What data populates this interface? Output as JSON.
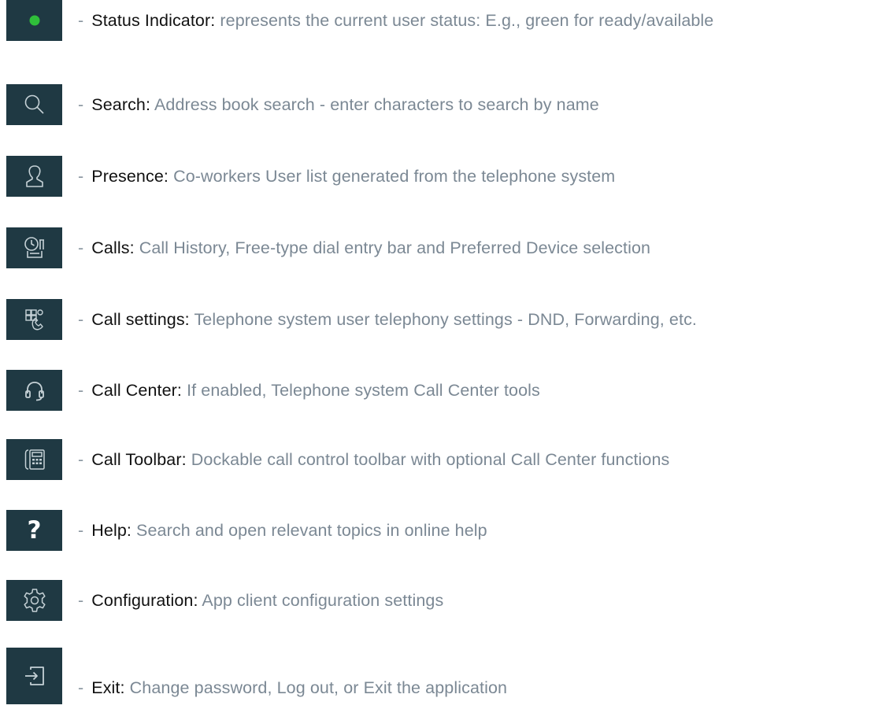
{
  "legend_items": [
    {
      "icon": "status-indicator-icon",
      "term": "Status Indicator",
      "description": "represents the current user status: E.g., green for ready/available"
    },
    {
      "icon": "search-icon",
      "term": "Search",
      "description": "Address book search - enter characters to search by name"
    },
    {
      "icon": "person-icon",
      "term": "Presence",
      "description": "Co-workers User list generated from the telephone system"
    },
    {
      "icon": "clock-phone-icon",
      "term": "Calls",
      "description": "Call History, Free-type dial entry bar and Preferred Device selection"
    },
    {
      "icon": "phone-settings-icon",
      "term": "Call settings",
      "description": "Telephone system user telephony settings - DND, Forwarding, etc."
    },
    {
      "icon": "headset-icon",
      "term": "Call Center",
      "description": "If enabled, Telephone system Call Center tools"
    },
    {
      "icon": "desk-phone-icon",
      "term": "Call Toolbar",
      "description": "Dockable call control toolbar with optional Call Center functions"
    },
    {
      "icon": "help-icon",
      "term": "Help",
      "description": "Search and open relevant topics in online help"
    },
    {
      "icon": "gear-icon",
      "term": "Configuration",
      "description": "App client configuration settings"
    },
    {
      "icon": "exit-icon",
      "term": "Exit",
      "description": "Change password, Log out, or Exit the application"
    }
  ],
  "help_glyph": "?",
  "separator": "-",
  "colon": ":",
  "colors": {
    "tile_background": "#1f3943",
    "icon_stroke": "#c5d1d6",
    "status_green": "#2fbf3a",
    "term_text": "#111111",
    "description_text": "#7b8894"
  }
}
